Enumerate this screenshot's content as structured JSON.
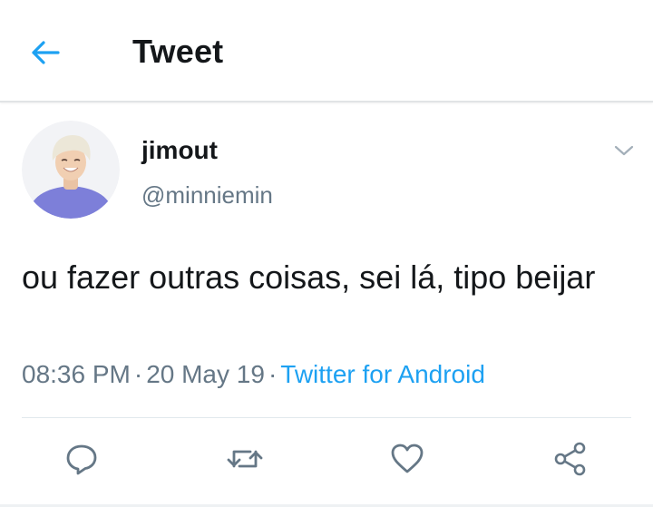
{
  "header": {
    "title": "Tweet",
    "back_icon": "arrow-left-icon",
    "accent_color": "#1da1f2"
  },
  "tweet": {
    "author": {
      "display_name": "jimout",
      "handle": "@minniemin"
    },
    "text": "ou fazer outras coisas, sei lá, tipo beijar",
    "time": "08:36 PM",
    "date": "20 May 19",
    "source": "Twitter for Android",
    "separator": "·"
  },
  "actions": [
    {
      "name": "reply",
      "icon": "reply-icon"
    },
    {
      "name": "retweet",
      "icon": "retweet-icon"
    },
    {
      "name": "like",
      "icon": "heart-icon"
    },
    {
      "name": "share",
      "icon": "share-icon"
    }
  ],
  "colors": {
    "text": "#14171a",
    "secondary": "#657786",
    "link": "#1da1f2"
  }
}
